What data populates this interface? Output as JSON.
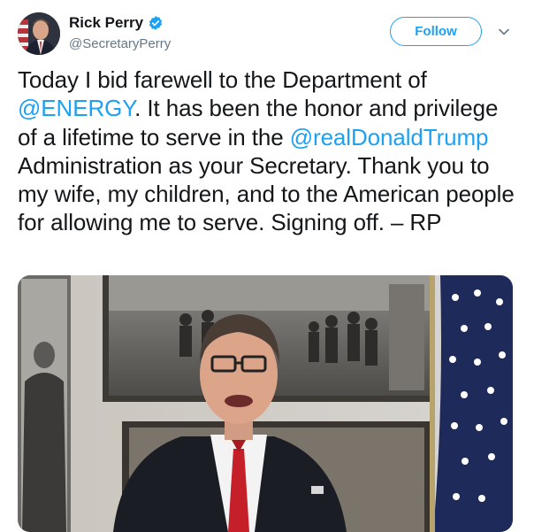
{
  "user": {
    "display_name": "Rick Perry",
    "handle": "@SecretaryPerry",
    "verified": true,
    "avatar_icon": "profile-photo"
  },
  "actions": {
    "follow_label": "Follow",
    "menu_icon": "chevron-down-icon"
  },
  "tweet": {
    "segments": [
      {
        "text": "Today I bid farewell to the Department of ",
        "type": "text"
      },
      {
        "text": "@ENERGY",
        "type": "mention"
      },
      {
        "text": ". It has been the honor and privilege of a lifetime to serve in the ",
        "type": "text"
      },
      {
        "text": "@realDonaldTrump",
        "type": "mention"
      },
      {
        "text": " Administration as your Secretary. Thank you to my wife, my children, and to the American people for allowing me to serve. Signing off. – RP",
        "type": "text"
      }
    ]
  },
  "media": {
    "kind": "video-thumbnail"
  },
  "colors": {
    "accent": "#1da1f2",
    "text": "#14171a",
    "secondary": "#657786"
  }
}
